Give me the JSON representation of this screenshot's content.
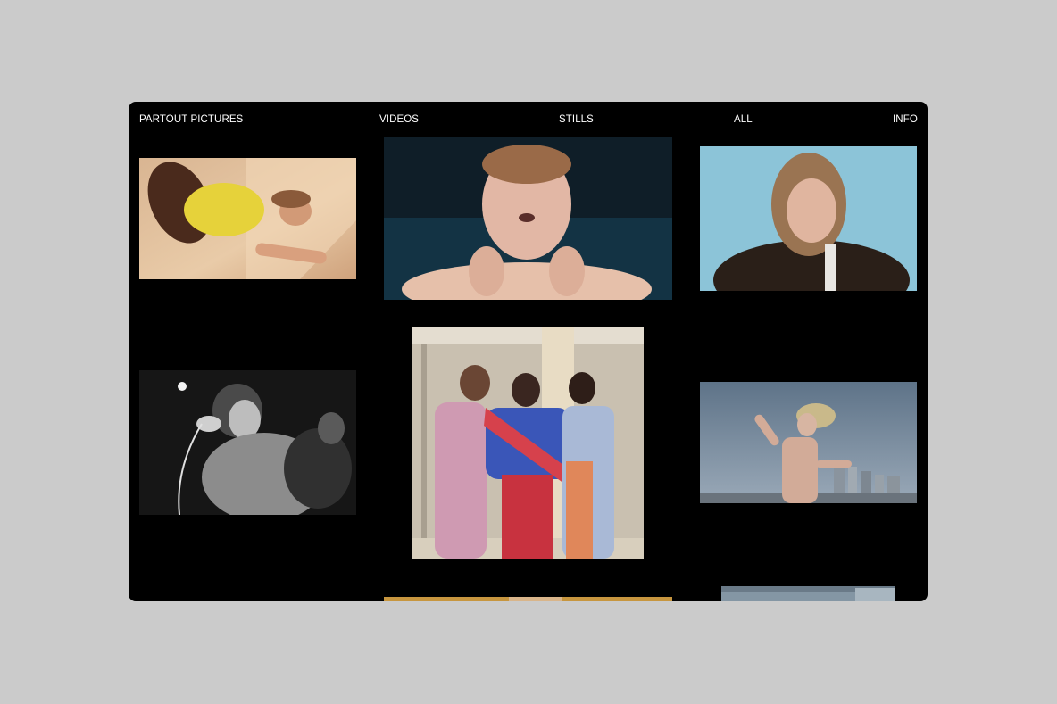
{
  "site": {
    "brand": "PARTOUT PICTURES",
    "nav": {
      "videos": "VIDEOS",
      "stills": "STILLS",
      "all": "ALL",
      "info": "INFO"
    }
  },
  "gallery": {
    "items": [
      {
        "subject": "man in yellow shirt lying on sunlit floor"
      },
      {
        "subject": "man with eyes closed, hands on neck, dark water"
      },
      {
        "subject": "long-haired man in fur coat against blue wall"
      },
      {
        "subject": "black and white singer with microphone"
      },
      {
        "subject": "three models in patterned outfits"
      },
      {
        "subject": "man with raised arm against cloudy city skyline"
      },
      {
        "subject": "partially visible warm-toned image"
      },
      {
        "subject": "partially visible cool-toned image"
      }
    ]
  },
  "colors": {
    "page_background": "#cbcbcb",
    "window_background": "#000000",
    "nav_text": "#ffffff"
  }
}
